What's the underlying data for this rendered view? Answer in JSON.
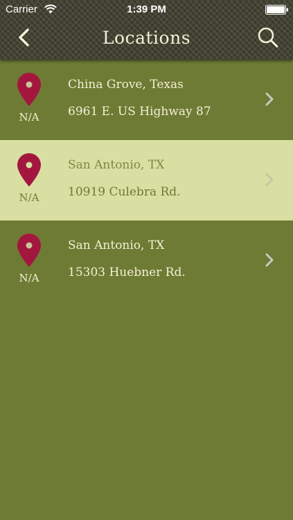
{
  "status": {
    "carrier": "Carrier",
    "time": "1:39 PM"
  },
  "header": {
    "title": "Locations",
    "back_icon": "chevron-left-icon",
    "search_icon": "search-icon"
  },
  "locations": [
    {
      "name": "China Grove, Texas",
      "address": "6961 E. US Highway 87",
      "distance": "N/A",
      "selected": false
    },
    {
      "name": "San Antonio, TX",
      "address": "10919 Culebra Rd.",
      "distance": "N/A",
      "selected": true
    },
    {
      "name": "San Antonio, TX",
      "address": "15303 Huebner Rd.",
      "distance": "N/A",
      "selected": false
    }
  ],
  "colors": {
    "background": "#6e7b34",
    "header": "#3f3f2f",
    "selected_row": "#d9dea2",
    "pin": "#a3173f",
    "text": "#f4f0d6"
  }
}
